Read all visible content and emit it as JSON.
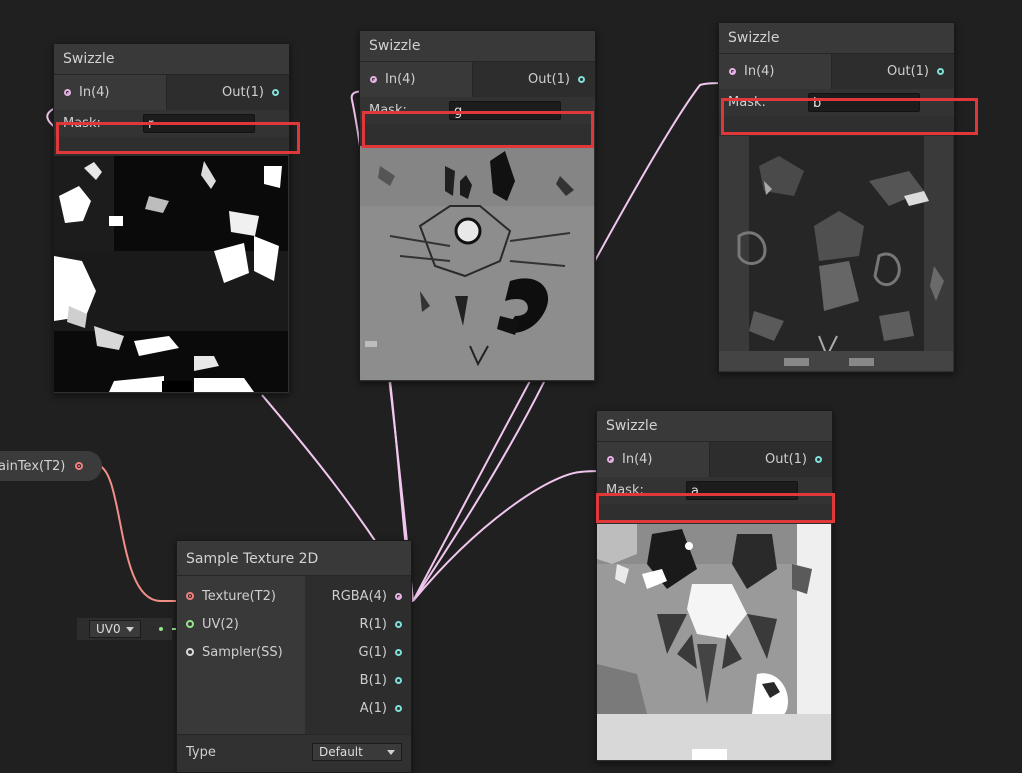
{
  "colors": {
    "canvas": "#202020",
    "node_body": "#2f2f2f",
    "node_title": "#393939",
    "wire_vector": "#f2c7ef",
    "wire_texture": "#f08f86",
    "wire_uv": "#97e38d",
    "port_out": "#7fe0d8",
    "highlight": "#e0383a"
  },
  "swizzle_nodes": [
    {
      "title": "Swizzle",
      "input_label": "In(4)",
      "output_label": "Out(1)",
      "mask_label": "Mask:",
      "mask_value": "r"
    },
    {
      "title": "Swizzle",
      "input_label": "In(4)",
      "output_label": "Out(1)",
      "mask_label": "Mask:",
      "mask_value": "g"
    },
    {
      "title": "Swizzle",
      "input_label": "In(4)",
      "output_label": "Out(1)",
      "mask_label": "Mask:",
      "mask_value": "b"
    },
    {
      "title": "Swizzle",
      "input_label": "In(4)",
      "output_label": "Out(1)",
      "mask_label": "Mask:",
      "mask_value": "a"
    }
  ],
  "property_node": {
    "label": "ainTex(T2)"
  },
  "uv_node": {
    "value": "UV0"
  },
  "sample_texture": {
    "title": "Sample Texture 2D",
    "inputs": [
      "Texture(T2)",
      "UV(2)",
      "Sampler(SS)"
    ],
    "outputs": [
      "RGBA(4)",
      "R(1)",
      "G(1)",
      "B(1)",
      "A(1)"
    ],
    "type_label": "Type",
    "type_value": "Default"
  }
}
